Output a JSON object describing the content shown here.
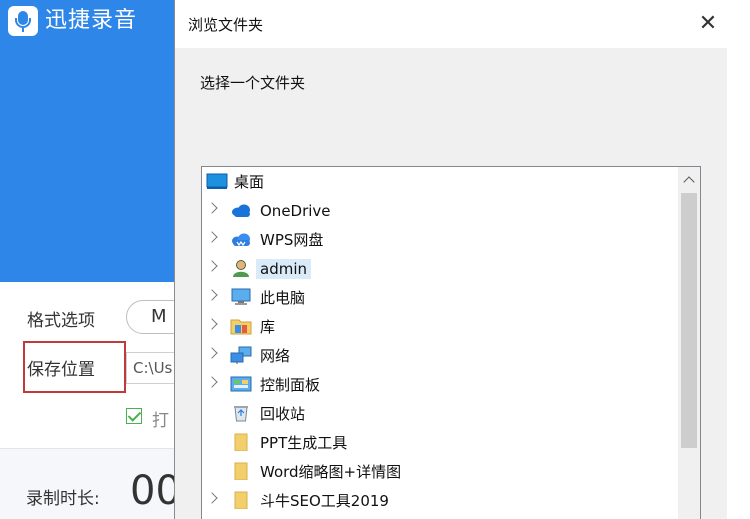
{
  "app": {
    "title": "迅捷录音",
    "format_label": "格式选项",
    "format_value": "M",
    "save_label": "保存位置",
    "save_path": "C:\\Us",
    "checkbox_label": "打",
    "duration_label": "录制时长:",
    "duration_value": "00"
  },
  "dialog": {
    "title": "浏览文件夹",
    "close_glyph": "✕",
    "prompt": "选择一个文件夹",
    "tree": [
      {
        "label": "桌面",
        "icon": "desktop-icon",
        "expandable": false,
        "level": 0
      },
      {
        "label": "OneDrive",
        "icon": "cloud-icon",
        "expandable": true,
        "level": 1
      },
      {
        "label": "WPS网盘",
        "icon": "wps-cloud-icon",
        "expandable": true,
        "level": 1
      },
      {
        "label": "admin",
        "icon": "user-icon",
        "expandable": true,
        "level": 1,
        "selected": true
      },
      {
        "label": "此电脑",
        "icon": "computer-icon",
        "expandable": true,
        "level": 1
      },
      {
        "label": "库",
        "icon": "library-icon",
        "expandable": true,
        "level": 1
      },
      {
        "label": "网络",
        "icon": "network-icon",
        "expandable": true,
        "level": 1
      },
      {
        "label": "控制面板",
        "icon": "control-panel-icon",
        "expandable": true,
        "level": 1
      },
      {
        "label": "回收站",
        "icon": "recycle-bin-icon",
        "expandable": false,
        "level": 1
      },
      {
        "label": "PPT生成工具",
        "icon": "folder-icon",
        "expandable": false,
        "level": 1
      },
      {
        "label": "Word缩略图+详情图",
        "icon": "folder-icon",
        "expandable": false,
        "level": 1
      },
      {
        "label": "斗牛SEO工具2019",
        "icon": "folder-icon",
        "expandable": true,
        "level": 1
      }
    ]
  },
  "colors": {
    "app_blue": "#2e86e8",
    "highlight_red": "#c0393b",
    "selection": "#d9ebf9",
    "folder": "#f3cf6b"
  }
}
